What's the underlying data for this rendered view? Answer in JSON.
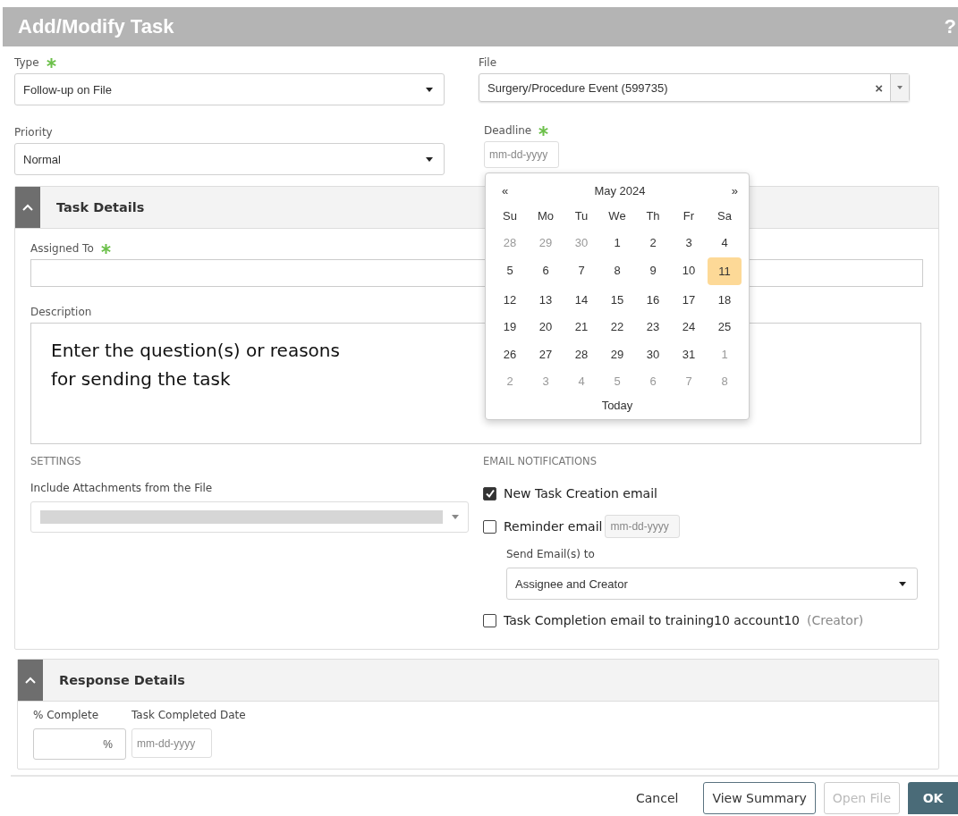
{
  "window": {
    "title": "Add/Modify Task",
    "help": "?"
  },
  "type": {
    "label": "Type",
    "required": true,
    "value": "Follow-up on File"
  },
  "priority": {
    "label": "Priority",
    "value": "Normal"
  },
  "file": {
    "label": "File",
    "value": "Surgery/Procedure Event (599735)",
    "clear": "×"
  },
  "deadline": {
    "label": "Deadline",
    "required": true,
    "placeholder": "mm-dd-yyyy"
  },
  "calendar": {
    "prev": "«",
    "month": "May 2024",
    "next": "»",
    "weekdays": [
      "Su",
      "Mo",
      "Tu",
      "We",
      "Th",
      "Fr",
      "Sa"
    ],
    "weeks": [
      [
        {
          "day": "28",
          "muted": true,
          "selected": false
        },
        {
          "day": "29",
          "muted": true,
          "selected": false
        },
        {
          "day": "30",
          "muted": true,
          "selected": false
        },
        {
          "day": "1",
          "muted": false,
          "selected": false
        },
        {
          "day": "2",
          "muted": false,
          "selected": false
        },
        {
          "day": "3",
          "muted": false,
          "selected": false
        },
        {
          "day": "4",
          "muted": false,
          "selected": false
        }
      ],
      [
        {
          "day": "5",
          "muted": false,
          "selected": false
        },
        {
          "day": "6",
          "muted": false,
          "selected": false
        },
        {
          "day": "7",
          "muted": false,
          "selected": false
        },
        {
          "day": "8",
          "muted": false,
          "selected": false
        },
        {
          "day": "9",
          "muted": false,
          "selected": false
        },
        {
          "day": "10",
          "muted": false,
          "selected": false
        },
        {
          "day": "11",
          "muted": false,
          "selected": true
        }
      ],
      [
        {
          "day": "12",
          "muted": false,
          "selected": false
        },
        {
          "day": "13",
          "muted": false,
          "selected": false
        },
        {
          "day": "14",
          "muted": false,
          "selected": false
        },
        {
          "day": "15",
          "muted": false,
          "selected": false
        },
        {
          "day": "16",
          "muted": false,
          "selected": false
        },
        {
          "day": "17",
          "muted": false,
          "selected": false
        },
        {
          "day": "18",
          "muted": false,
          "selected": false
        }
      ],
      [
        {
          "day": "19",
          "muted": false,
          "selected": false
        },
        {
          "day": "20",
          "muted": false,
          "selected": false
        },
        {
          "day": "21",
          "muted": false,
          "selected": false
        },
        {
          "day": "22",
          "muted": false,
          "selected": false
        },
        {
          "day": "23",
          "muted": false,
          "selected": false
        },
        {
          "day": "24",
          "muted": false,
          "selected": false
        },
        {
          "day": "25",
          "muted": false,
          "selected": false
        }
      ],
      [
        {
          "day": "26",
          "muted": false,
          "selected": false
        },
        {
          "day": "27",
          "muted": false,
          "selected": false
        },
        {
          "day": "28",
          "muted": false,
          "selected": false
        },
        {
          "day": "29",
          "muted": false,
          "selected": false
        },
        {
          "day": "30",
          "muted": false,
          "selected": false
        },
        {
          "day": "31",
          "muted": false,
          "selected": false
        },
        {
          "day": "1",
          "muted": true,
          "selected": false
        }
      ],
      [
        {
          "day": "2",
          "muted": true,
          "selected": false
        },
        {
          "day": "3",
          "muted": true,
          "selected": false
        },
        {
          "day": "4",
          "muted": true,
          "selected": false
        },
        {
          "day": "5",
          "muted": true,
          "selected": false
        },
        {
          "day": "6",
          "muted": true,
          "selected": false
        },
        {
          "day": "7",
          "muted": true,
          "selected": false
        },
        {
          "day": "8",
          "muted": true,
          "selected": false
        }
      ]
    ],
    "today": "Today"
  },
  "task_details": {
    "title": "Task Details",
    "expanded": true,
    "assigned_to": {
      "label": "Assigned To",
      "required": true
    },
    "description": {
      "label": "Description",
      "value": "Enter the question(s) or reasons\nfor sending the task"
    },
    "settings": {
      "heading": "SETTINGS",
      "attachments_label": "Include Attachments from the File"
    },
    "email": {
      "heading": "EMAIL NOTIFICATIONS",
      "items": [
        {
          "kind": "checkbox",
          "label": "New Task Creation email",
          "checked": true
        },
        {
          "kind": "checkbox_date",
          "label": "Reminder email",
          "checked": false,
          "placeholder": "mm-dd-yyyy"
        },
        {
          "kind": "select",
          "label": "Send Email(s) to",
          "value": "Assignee and Creator"
        },
        {
          "kind": "checkbox",
          "label": "Task Completion email to training10 account10",
          "note": "(Creator)",
          "checked": false
        }
      ]
    }
  },
  "response_details": {
    "title": "Response Details",
    "expanded": true,
    "percent_label": "% Complete",
    "percent_unit": "%",
    "date_label": "Task Completed Date",
    "date_placeholder": "mm-dd-yyyy"
  },
  "buttons": [
    {
      "label": "Cancel",
      "kind": "link",
      "disabled": false
    },
    {
      "label": "View Summary",
      "kind": "outline",
      "disabled": false
    },
    {
      "label": "Open File",
      "kind": "outline",
      "disabled": true
    },
    {
      "label": "OK",
      "kind": "primary",
      "disabled": false
    }
  ]
}
